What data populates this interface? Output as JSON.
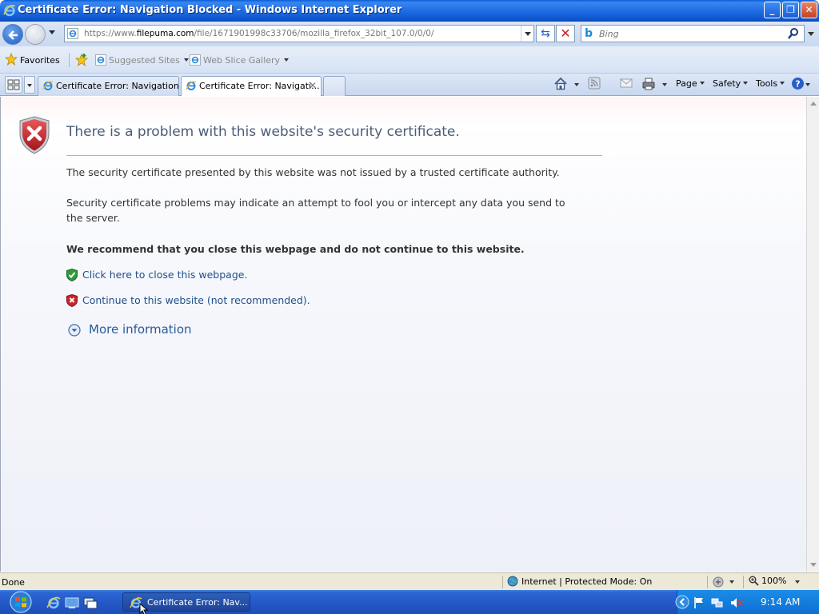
{
  "window": {
    "title": "Certificate Error: Navigation Blocked - Windows Internet Explorer",
    "minimize": "_",
    "maximize": "❐",
    "close": "✕"
  },
  "addressbar": {
    "url_prefix": "https://www.",
    "url_domain": "filepuma.com",
    "url_path": "/file/1671901998c33706/mozilla_firefox_32bit_107.0/0/0/",
    "search_placeholder": "Bing"
  },
  "favorites_bar": {
    "favorites_label": "Favorites",
    "links": [
      {
        "label": "Suggested Sites"
      },
      {
        "label": "Web Slice Gallery"
      }
    ]
  },
  "tabs": [
    {
      "label": "Certificate Error: Navigation ...",
      "active": false
    },
    {
      "label": "Certificate Error: Navigati...",
      "active": true
    }
  ],
  "command_bar": {
    "page": "Page",
    "safety": "Safety",
    "tools": "Tools"
  },
  "content": {
    "heading": "There is a problem with this website's security certificate.",
    "para1": "The security certificate presented by this website was not issued by a trusted certificate authority.",
    "para2": "Security certificate problems may indicate an attempt to fool you or intercept any data you send to the server.",
    "recommend": "We recommend that you close this webpage and do not continue to this website.",
    "close_link": "Click here to close this webpage.",
    "continue_link": "Continue to this website (not recommended).",
    "more_info": "More information"
  },
  "statusbar": {
    "status": "Done",
    "zone": "Internet | Protected Mode: On",
    "zoom": "100%"
  },
  "taskbar": {
    "task_label": "Certificate Error: Nav...",
    "clock": "9:14 AM"
  },
  "colors": {
    "title_blue": "#1e6de4",
    "heading": "#4b5c77",
    "link": "#1f4f8c",
    "shield_red": "#c8262b",
    "shield_green": "#2f9a3a"
  }
}
